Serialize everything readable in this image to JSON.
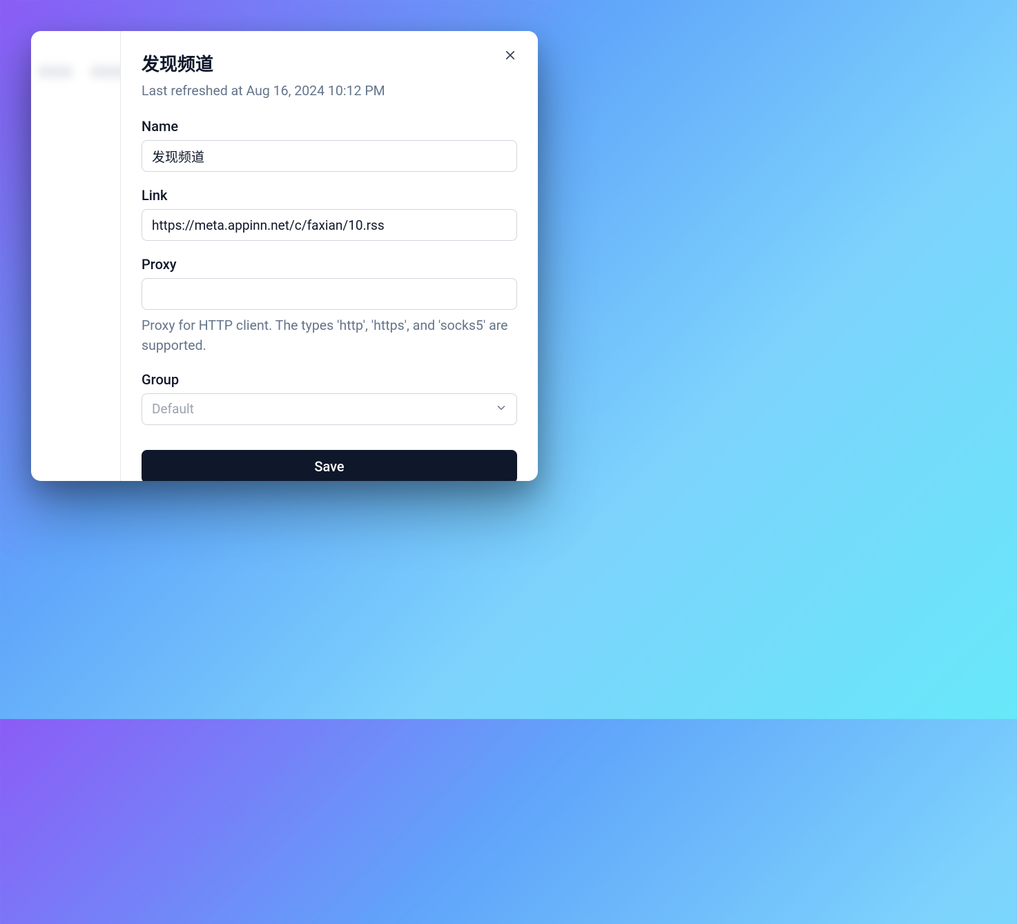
{
  "modal": {
    "title": "发现频道",
    "subtitle": "Last refreshed at Aug 16, 2024 10:12 PM",
    "fields": {
      "name": {
        "label": "Name",
        "value": "发现频道"
      },
      "link": {
        "label": "Link",
        "value": "https://meta.appinn.net/c/faxian/10.rss"
      },
      "proxy": {
        "label": "Proxy",
        "value": "",
        "helper": "Proxy for HTTP client. The types 'http', 'https', and 'socks5' are supported."
      },
      "group": {
        "label": "Group",
        "selected": "Default"
      }
    },
    "save_label": "Save"
  }
}
